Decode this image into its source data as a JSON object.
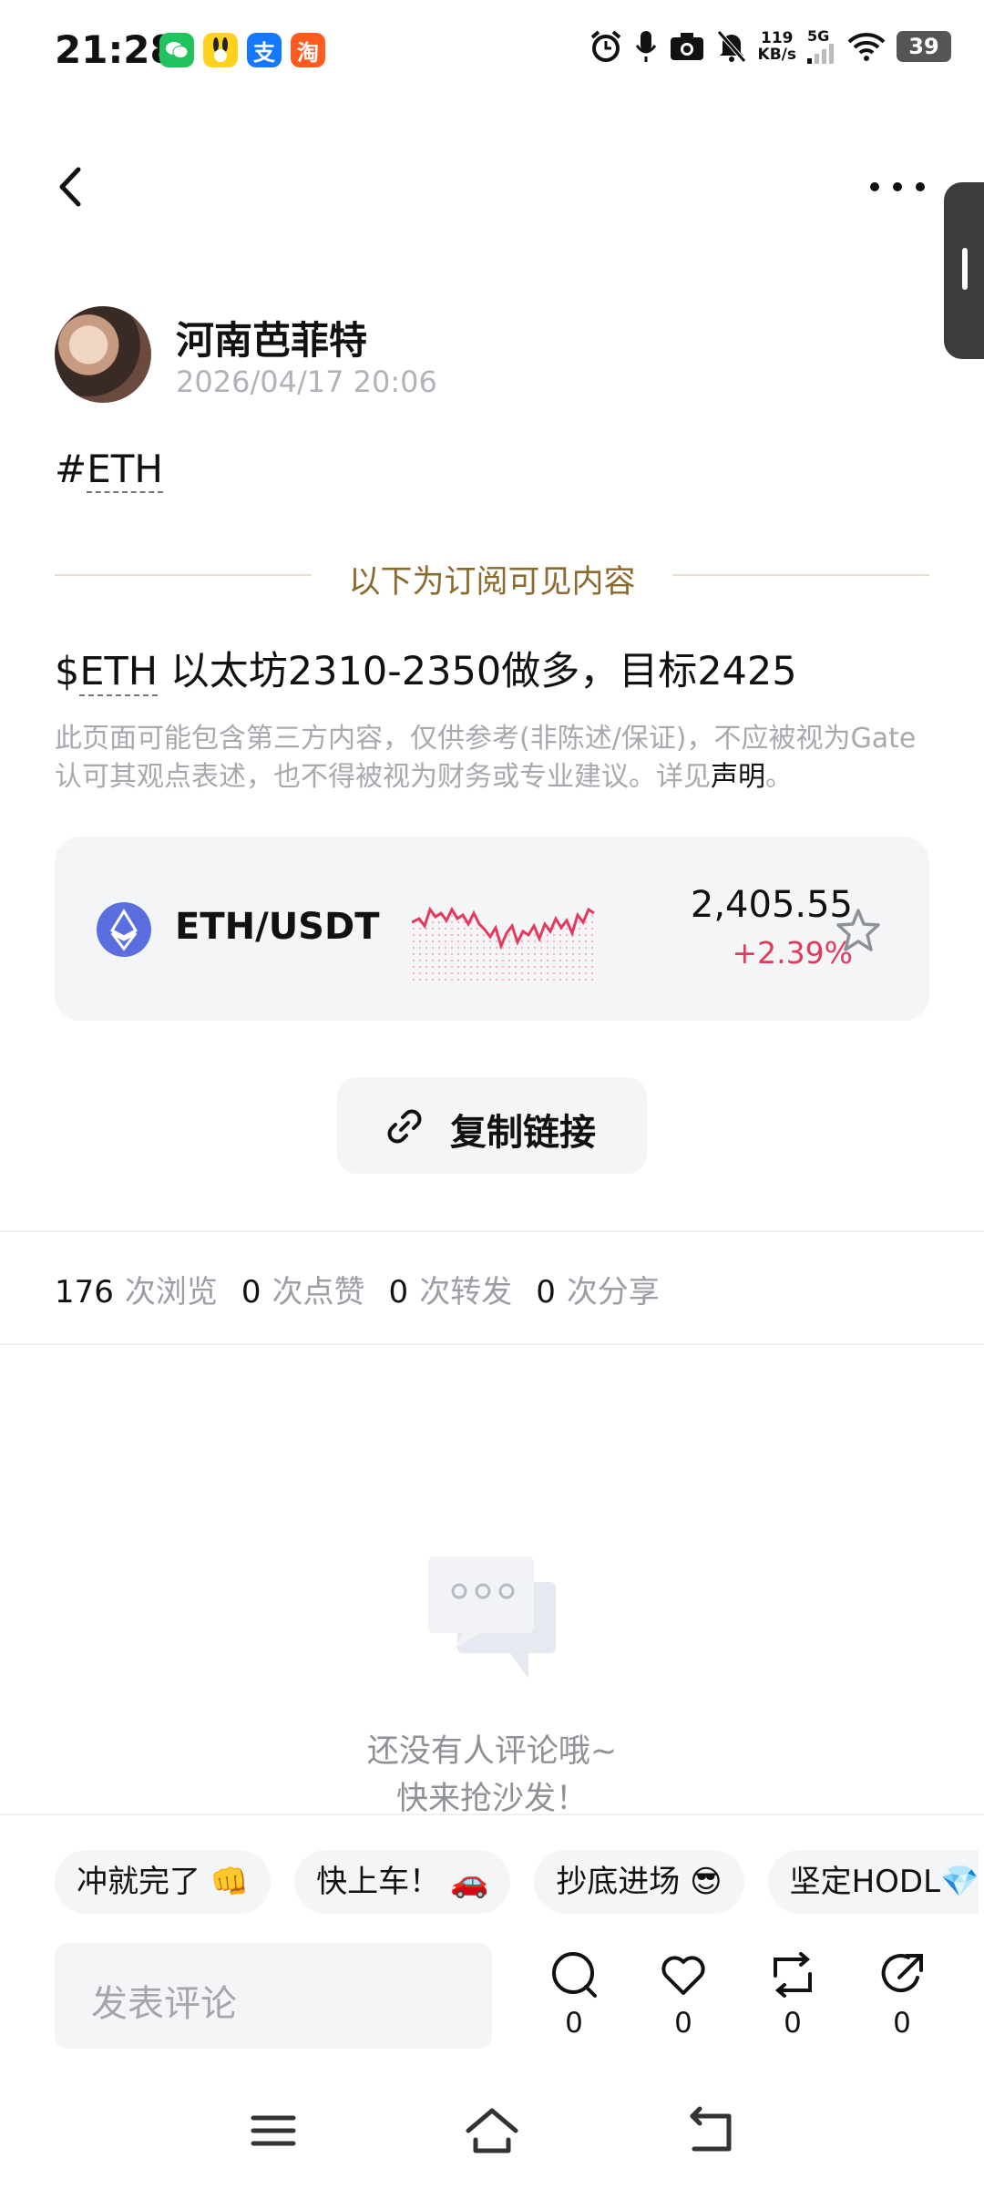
{
  "status_bar": {
    "time": "21:28",
    "apps": [
      "wechat-icon",
      "bunny-app-icon",
      "alipay-icon",
      "taobao-icon"
    ],
    "net_speed_value": "119",
    "net_speed_unit": "KB/s",
    "network": "5G",
    "battery": "39"
  },
  "post": {
    "author": "河南芭菲特",
    "time": "2026/04/17 20:06",
    "hashtag_prefix": "#",
    "hashtag_token": "ETH",
    "subscription_notice": "以下为订阅可见内容",
    "body_prefix": "$",
    "body_token": "ETH",
    "body_rest": " 以太坊2310-2350做多，目标2425",
    "disclaimer": "此页面可能包含第三方内容，仅供参考(非陈述/保证)，不应被视为Gate认可其观点表述，也不得被视为财务或专业建议。详见",
    "disclaimer_link": "声明",
    "disclaimer_end": "。"
  },
  "market": {
    "pair": "ETH/USDT",
    "price": "2,405.55",
    "change": "+2.39%",
    "change_color": "#e23a5d"
  },
  "copy_link_label": "复制链接",
  "stats": [
    {
      "num": "176",
      "unit": "次浏览"
    },
    {
      "num": "0",
      "unit": "次点赞"
    },
    {
      "num": "0",
      "unit": "次转发"
    },
    {
      "num": "0",
      "unit": "次分享"
    }
  ],
  "comments": {
    "empty_line1": "还没有人评论哦~",
    "empty_line2": "快来抢沙发！"
  },
  "quick_replies": [
    "冲就完了 👊",
    "快上车！ 🚗",
    "抄底进场 😎",
    "坚定HODL💎"
  ],
  "comment_input_placeholder": "发表评论",
  "actions": {
    "comment_count": "0",
    "like_count": "0",
    "repost_count": "0",
    "share_count": "0"
  }
}
